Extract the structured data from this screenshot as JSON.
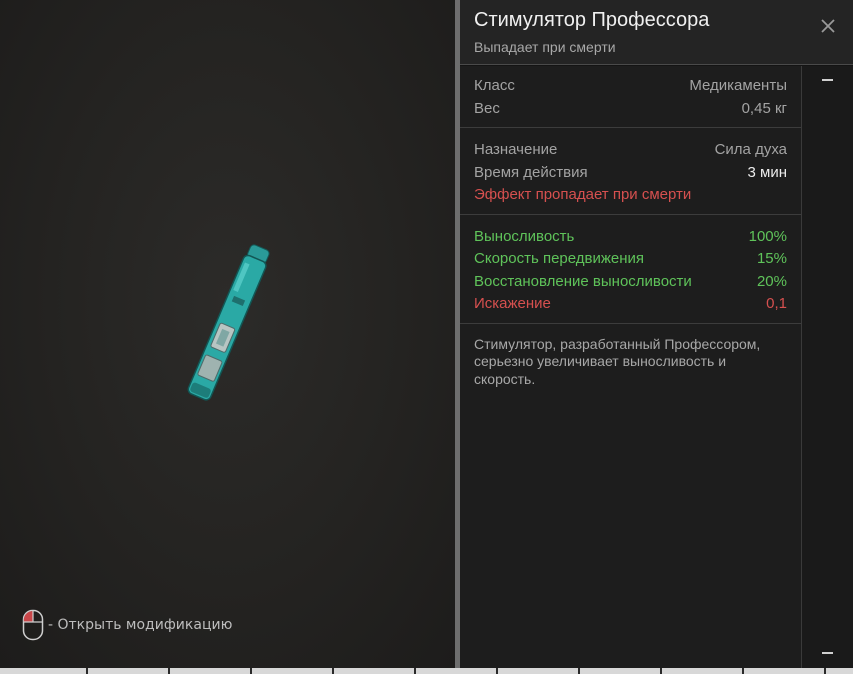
{
  "item": {
    "title": "Стимулятор Профессора",
    "subtitle": "Выпадает при смерти"
  },
  "basic": [
    {
      "label": "Класс",
      "value": "Медикаменты"
    },
    {
      "label": "Вес",
      "value": "0,45 кг"
    }
  ],
  "usage": {
    "purpose_label": "Назначение",
    "purpose_value": "Сила духа",
    "duration_label": "Время действия",
    "duration_value": "3 мин",
    "warning": "Эффект пропадает при смерти"
  },
  "effects": [
    {
      "label": "Выносливость",
      "value": "100%",
      "color": "#5fc35a"
    },
    {
      "label": "Скорость передвижения",
      "value": "15%",
      "color": "#5fc35a"
    },
    {
      "label": "Восстановление выносливости",
      "value": "20%",
      "color": "#5fc35a"
    },
    {
      "label": "Искажение",
      "value": "0,1",
      "color": "#d6504f"
    }
  ],
  "description": "Стимулятор, разработанный Профессором, серьезно увеличивает выносливость и скорость.",
  "hint": {
    "text": "- Открыть модификацию",
    "icon": "mouse-icon"
  },
  "colors": {
    "positive": "#5fc35a",
    "negative": "#d6504f",
    "syringe": "#2aa9a5"
  }
}
